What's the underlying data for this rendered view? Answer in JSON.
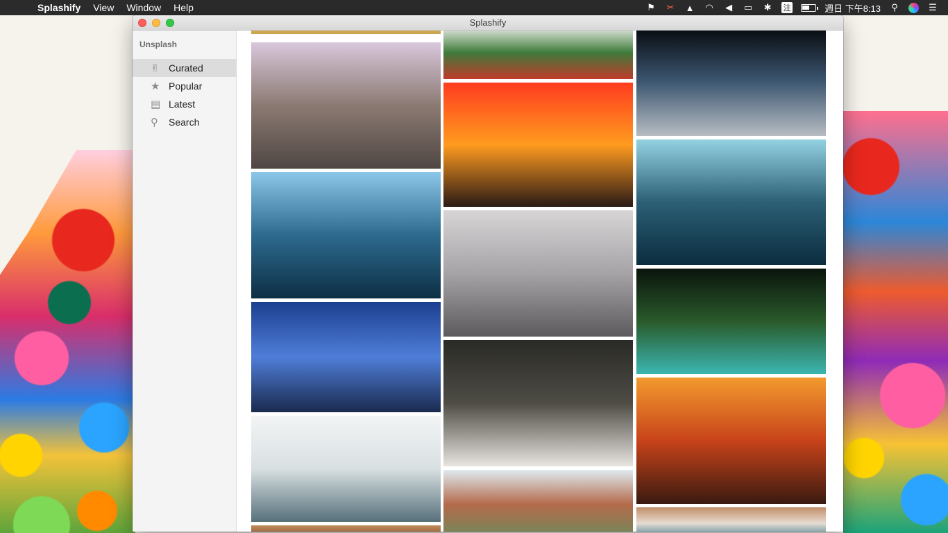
{
  "menubar": {
    "apple_glyph": "",
    "app_name": "Splashify",
    "menus": [
      "View",
      "Window",
      "Help"
    ],
    "status": {
      "input_method": "注",
      "clock": "週日 下午8:13"
    }
  },
  "window": {
    "title": "Splashify"
  },
  "sidebar": {
    "section_title": "Unsplash",
    "items": [
      {
        "label": "Curated",
        "icon": "thumbs-up-icon",
        "active": true
      },
      {
        "label": "Popular",
        "icon": "star-icon",
        "active": false
      },
      {
        "label": "Latest",
        "icon": "clapperboard-icon",
        "active": false
      },
      {
        "label": "Search",
        "icon": "magnifier-icon",
        "active": false
      }
    ]
  },
  "photos": [
    {
      "name": "photo-hint-top-left",
      "subject": "partial golden photo",
      "colors": [
        "#d9b86a",
        "#c9a24b"
      ]
    },
    {
      "name": "photo-rock-mountain-mist",
      "subject": "rocky peaks above fog",
      "colors": [
        "#d9c7dc",
        "#8b7a72",
        "#4f4643"
      ]
    },
    {
      "name": "photo-ocean-swimmer",
      "subject": "swimmer in ocean waves",
      "colors": [
        "#8cc6e8",
        "#2d6a8e",
        "#0d2f44"
      ]
    },
    {
      "name": "photo-lighthouse-blue",
      "subject": "lighthouse on rocky coast",
      "colors": [
        "#1c3f8f",
        "#4f7ed8",
        "#1a2a4e"
      ]
    },
    {
      "name": "photo-island-clouds",
      "subject": "island seen through clouds",
      "colors": [
        "#f2f4f5",
        "#d9e0e2",
        "#56707a"
      ]
    },
    {
      "name": "photo-hint-bottom-left",
      "subject": "partial warm photo",
      "colors": [
        "#c08a5a",
        "#7b4a2e"
      ]
    },
    {
      "name": "photo-red-berries",
      "subject": "branches with red berries",
      "colors": [
        "#e8ece6",
        "#3f7a3a",
        "#c03a2b"
      ]
    },
    {
      "name": "photo-fiery-sky",
      "subject": "fiery sky above clouds",
      "colors": [
        "#ff3c1f",
        "#ff9b1f",
        "#2a1a16"
      ]
    },
    {
      "name": "photo-foggy-bridge",
      "subject": "bridge disappearing into fog",
      "colors": [
        "#d8d5d7",
        "#a6a3a6",
        "#5d5a5e"
      ]
    },
    {
      "name": "photo-swan",
      "subject": "white swan on dark water",
      "colors": [
        "#2a2a26",
        "#4e4c45",
        "#e8e5e0"
      ]
    },
    {
      "name": "photo-colorful-hills",
      "subject": "mountain range with colorful slopes",
      "colors": [
        "#dfeaf0",
        "#b46a4a",
        "#6b8a5a"
      ]
    },
    {
      "name": "photo-moon-clouds",
      "subject": "full moon in dark clouds",
      "colors": [
        "#06080c",
        "#3c5670",
        "#b7bcc2"
      ]
    },
    {
      "name": "photo-lava-ocean",
      "subject": "lava meeting ocean under steam",
      "colors": [
        "#93d2e2",
        "#2c5f75",
        "#0b2c3f"
      ]
    },
    {
      "name": "photo-forest-waterfall",
      "subject": "waterfall in dark forest",
      "colors": [
        "#0a140b",
        "#2a5a2b",
        "#3bb6b1"
      ]
    },
    {
      "name": "photo-sunset-planes",
      "subject": "airplanes against sunset",
      "colors": [
        "#f29a2e",
        "#c8431a",
        "#3a1a10"
      ]
    },
    {
      "name": "photo-aerial-beach",
      "subject": "aerial beach with waves",
      "colors": [
        "#c28e68",
        "#e6dcd1",
        "#3a7a8e"
      ]
    }
  ]
}
